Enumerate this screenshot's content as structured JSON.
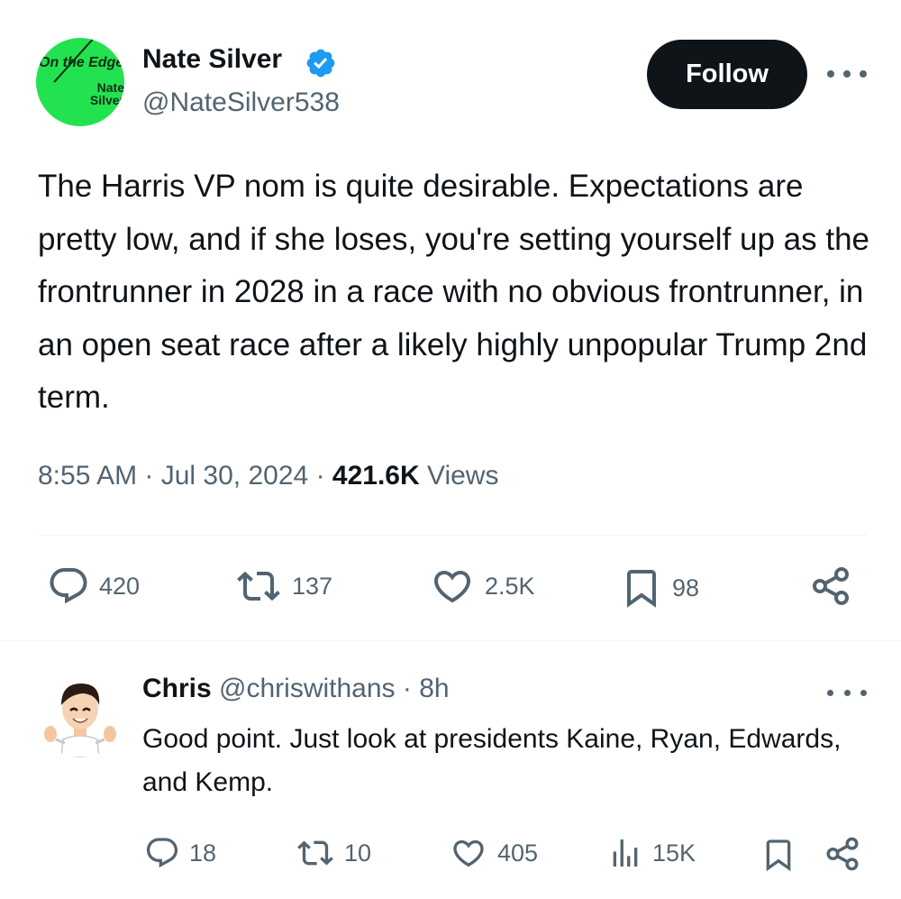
{
  "tweet": {
    "avatar": {
      "line1": "On the Edge",
      "line2": "Nate Silver",
      "color": "#22e34f"
    },
    "author_name": "Nate Silver",
    "author_handle": "@NateSilver538",
    "verified": true,
    "follow_label": "Follow",
    "text": "The Harris VP nom is quite desirable. Expectations are pretty low, and if she loses, you're setting yourself up as the frontrunner in 2028 in a race with no obvious frontrunner, in an open seat race after a likely highly unpopular Trump 2nd term.",
    "time": "8:55 AM",
    "date": "Jul 30, 2024",
    "views_count": "421.6K",
    "views_label": "Views",
    "actions": {
      "replies": "420",
      "reposts": "137",
      "likes": "2.5K",
      "bookmarks": "98"
    },
    "icons": [
      "reply-icon",
      "repost-icon",
      "like-icon",
      "bookmark-icon",
      "share-icon",
      "more-icon",
      "verified-icon"
    ]
  },
  "reply": {
    "author_name": "Chris",
    "author_handle": "@chriswithans",
    "age": "8h",
    "text": "Good point.  Just look at presidents Kaine, Ryan, Edwards, and Kemp.",
    "actions": {
      "replies": "18",
      "reposts": "10",
      "likes": "405",
      "views": "15K"
    }
  },
  "colors": {
    "text": "#0f1419",
    "secondary": "#536471",
    "verified_blue": "#1d9bf0",
    "button": "#0f1419",
    "divider": "#eff3f4"
  }
}
